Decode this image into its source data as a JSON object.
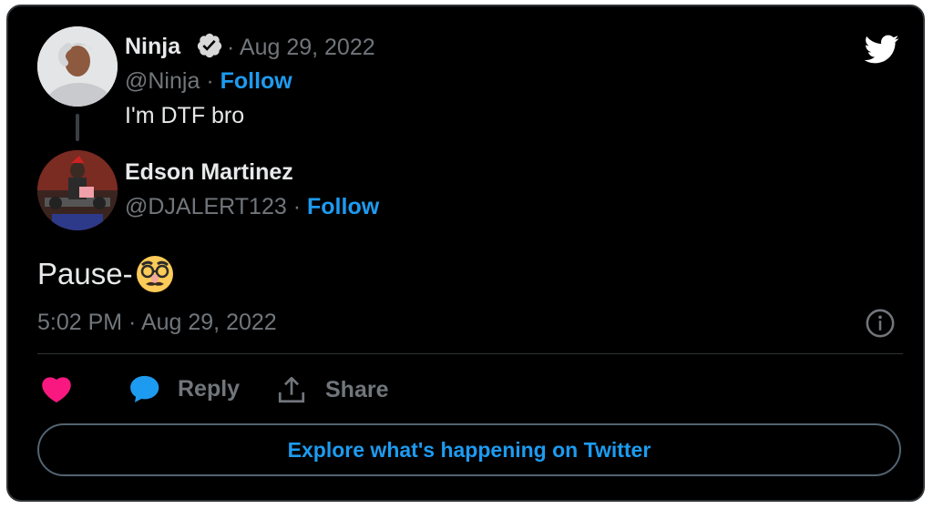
{
  "parent_tweet": {
    "display_name": "Ninja",
    "verified_icon": "verified-badge-icon",
    "date": "· Aug 29, 2022",
    "handle": "@Ninja",
    "separator": "·",
    "follow_label": "Follow",
    "text": "I'm DTF bro"
  },
  "reply_tweet": {
    "display_name": "Edson Martinez",
    "handle": "@DJALERT123",
    "separator": "·",
    "follow_label": "Follow",
    "text": "Pause-",
    "emoji": "disguised-face-emoji",
    "timestamp": "5:02 PM · Aug 29, 2022"
  },
  "actions": {
    "like_icon": "heart-icon",
    "reply_label": "Reply",
    "share_label": "Share"
  },
  "explore_label": "Explore what's happening on Twitter",
  "colors": {
    "background": "#000000",
    "text": "#e7e9ea",
    "muted": "#71767b",
    "accent": "#1d9bf0",
    "like": "#f91880",
    "border": "#2f3336"
  }
}
